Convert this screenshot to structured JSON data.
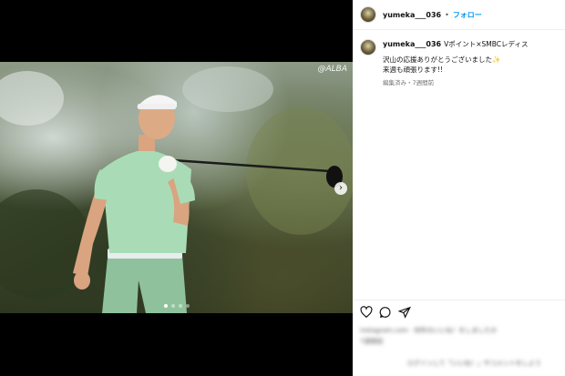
{
  "photo": {
    "watermark": "@ALBA",
    "carousel_dots": 4,
    "active_dot": 1
  },
  "post": {
    "username": "yumeka___036",
    "follow_label": "フォロー",
    "separator": "•",
    "caption_title": "Vポイント×SMBCレディス",
    "caption_body": "沢山の応援ありがとうございました✨\n来週も頑張ります!!",
    "meta": "編集済み・7週間前"
  },
  "blurred": {
    "likes_line": "instagram.com · 何件のいいね！をしましたか",
    "date_line": "7週間前",
    "footer_line": "ログインして「いいね！」やコメントをしよう"
  },
  "colors": {
    "accent": "#0095f6",
    "text": "#111111",
    "muted": "#737373"
  }
}
